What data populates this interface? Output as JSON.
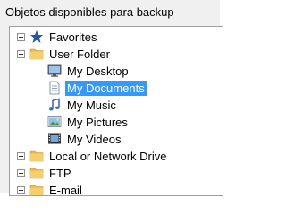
{
  "panel": {
    "title": "Objetos disponibles para backup"
  },
  "tree": {
    "items": [
      {
        "label": "Favorites",
        "expander": "plus",
        "icon": "star-icon"
      },
      {
        "label": "User Folder",
        "expander": "minus",
        "icon": "folder-icon"
      },
      {
        "label": "My Desktop",
        "icon": "desktop-icon"
      },
      {
        "label": "My Documents",
        "icon": "documents-icon",
        "selected": true
      },
      {
        "label": "My Music",
        "icon": "music-note-icon"
      },
      {
        "label": "My Pictures",
        "icon": "pictures-icon"
      },
      {
        "label": "My Videos",
        "icon": "videos-icon"
      },
      {
        "label": "Local or Network Drive",
        "expander": "plus",
        "icon": "folder-icon"
      },
      {
        "label": "FTP",
        "expander": "plus",
        "icon": "folder-icon"
      },
      {
        "label": "E-mail",
        "expander": "plus",
        "icon": "folder-icon"
      }
    ]
  },
  "colors": {
    "selection": "#3399ff",
    "star": "#1f5aa8",
    "folder": "#e8b84a"
  }
}
